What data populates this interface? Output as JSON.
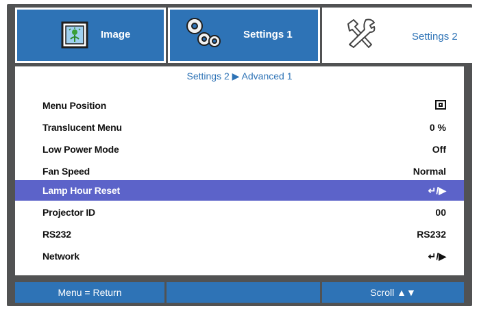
{
  "tabs": {
    "image": "Image",
    "settings1": "Settings 1",
    "settings2": "Settings 2"
  },
  "breadcrumb": "Settings 2 ▶ Advanced 1",
  "rows": [
    {
      "label": "Menu Position",
      "value": ""
    },
    {
      "label": "Translucent Menu",
      "value": "0 %"
    },
    {
      "label": "Low Power Mode",
      "value": "Off"
    },
    {
      "label": "Fan Speed",
      "value": "Normal"
    },
    {
      "label": "Lamp Hour Reset",
      "value": "↵/▶"
    },
    {
      "label": "Projector ID",
      "value": "00"
    },
    {
      "label": "RS232",
      "value": "RS232"
    },
    {
      "label": "Network",
      "value": "↵/▶"
    }
  ],
  "footer": {
    "left": "Menu = Return",
    "middle": "",
    "right": "Scroll ▲▼"
  },
  "colors": {
    "accent": "#2e73b6",
    "selected": "#5c63c9",
    "frame": "#515253"
  }
}
